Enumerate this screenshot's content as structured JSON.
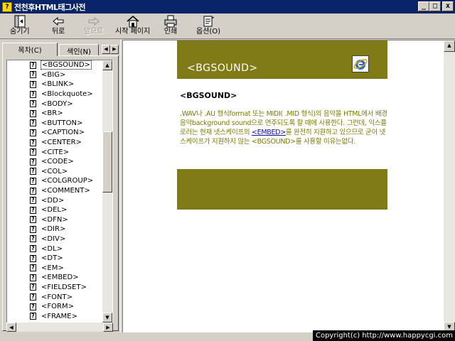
{
  "window": {
    "title": "전천후HTML태그사전",
    "minimize_glyph": "_",
    "maximize_glyph": "□",
    "close_glyph": "x"
  },
  "toolbar": {
    "hide_label": "숨기기",
    "back_label": "뒤로",
    "forward_label": "앞으로",
    "home_label": "시작 페이지",
    "print_label": "인쇄",
    "options_label": "옵션(O)"
  },
  "tabs": {
    "contents_label": "목차(C)",
    "index_label": "색인(N)"
  },
  "tree": {
    "items": [
      "<BGSOUND>",
      "<BIG>",
      "<BLINK>",
      "<Blockquote>",
      "<BODY>",
      "<BR>",
      "<BUTTON>",
      "<CAPTION>",
      "<CENTER>",
      "<CITE>",
      "<CODE>",
      "<COL>",
      "<COLGROUP>",
      "<COMMENT>",
      "<DD>",
      "<DEL>",
      "<DFN>",
      "<DIR>",
      "<DIV>",
      "<DL>",
      "<DT>",
      "<EM>",
      "<EMBED>",
      "<FIELDSET>",
      "<FONT>",
      "<FORM>",
      "<FRAME>"
    ],
    "selected": "<BGSOUND>"
  },
  "document": {
    "header_title": "<BGSOUND>",
    "heading": "<BGSOUND>",
    "body_part1": ".WAV나 .AU 형식format 또는 MIDI( .MID 형식)의 음악을 HTML에서 배경음악background sound으로 연주되도록 할 때에 사용한다. 그런데, 익스플로러는 현재 넷스케이프의 ",
    "body_link": "<EMBED>",
    "body_part2": "를 완전히 지원하고 있으므로 굳이 넷스케이프가 지원하지 않는 <BGSOUND>를 사용할 이유는없다."
  },
  "footer": {
    "copyright": "Copyright(c) http://www.happycgi.com"
  },
  "colors": {
    "titlebar": "#0a246a",
    "band": "#807a17",
    "body_text": "#7a7a00",
    "link": "#1010a0"
  },
  "icons": {
    "hide": "hide-pane-icon",
    "back": "back-arrow-icon",
    "forward": "forward-arrow-icon",
    "home": "home-icon",
    "print": "printer-icon",
    "options": "options-icon",
    "topic": "help-topic-icon",
    "ie": "internet-explorer-icon"
  }
}
